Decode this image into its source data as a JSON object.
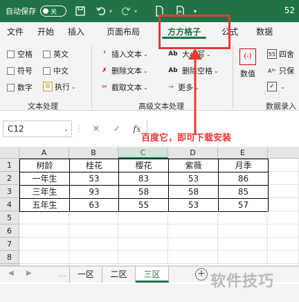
{
  "titlebar": {
    "autosave_label": "自动保存",
    "autosave_state": "关",
    "title_suffix": "52"
  },
  "tabs": [
    {
      "label": "文件"
    },
    {
      "label": "开始"
    },
    {
      "label": "插入"
    },
    {
      "label": "页面布局"
    },
    {
      "label": "方方格子",
      "active": true
    },
    {
      "label": "公式"
    },
    {
      "label": "数据"
    }
  ],
  "ribbon": {
    "text_group": {
      "checkboxes": [
        "空格",
        "英文",
        "符号",
        "中文",
        "数字"
      ],
      "exec_label": "执行",
      "group_label": "文本处理"
    },
    "advanced_group": {
      "insert_text": "插入文本",
      "delete_text": "删除文本",
      "cut_text": "截取文本",
      "case_label": "大小写",
      "delete_space": "删除空格",
      "more": "更多",
      "group_label": "高级文本处理"
    },
    "data_group": {
      "value_label": "数值",
      "round_label": "四舍",
      "only_label": "只保",
      "group_label": "数据录入"
    }
  },
  "formula_bar": {
    "name_box": "C12",
    "cancel": "✕",
    "confirm": "✓",
    "fx": "fx",
    "formula": ""
  },
  "sheet": {
    "columns": [
      "A",
      "B",
      "C",
      "D",
      "E"
    ],
    "selected_column": "C",
    "rows": [
      "1",
      "2",
      "3",
      "4",
      "5",
      "6",
      "7",
      "8",
      "9"
    ],
    "header": [
      "树龄",
      "桂花",
      "樱花",
      "紫薇",
      "月季"
    ],
    "data": [
      [
        "一年生",
        "53",
        "83",
        "53",
        "86"
      ],
      [
        "三年生",
        "93",
        "58",
        "58",
        "85"
      ],
      [
        "五年生",
        "63",
        "55",
        "53",
        "57"
      ]
    ]
  },
  "sheet_tabs": [
    {
      "label": "一区"
    },
    {
      "label": "二区"
    },
    {
      "label": "三区",
      "active": true
    }
  ],
  "annotation": {
    "text": "百度它，即可下载安装",
    "color": "#e53935"
  },
  "watermark": "软件技巧",
  "colors": {
    "excel_green": "#217346",
    "annotation_red": "#e53935"
  }
}
